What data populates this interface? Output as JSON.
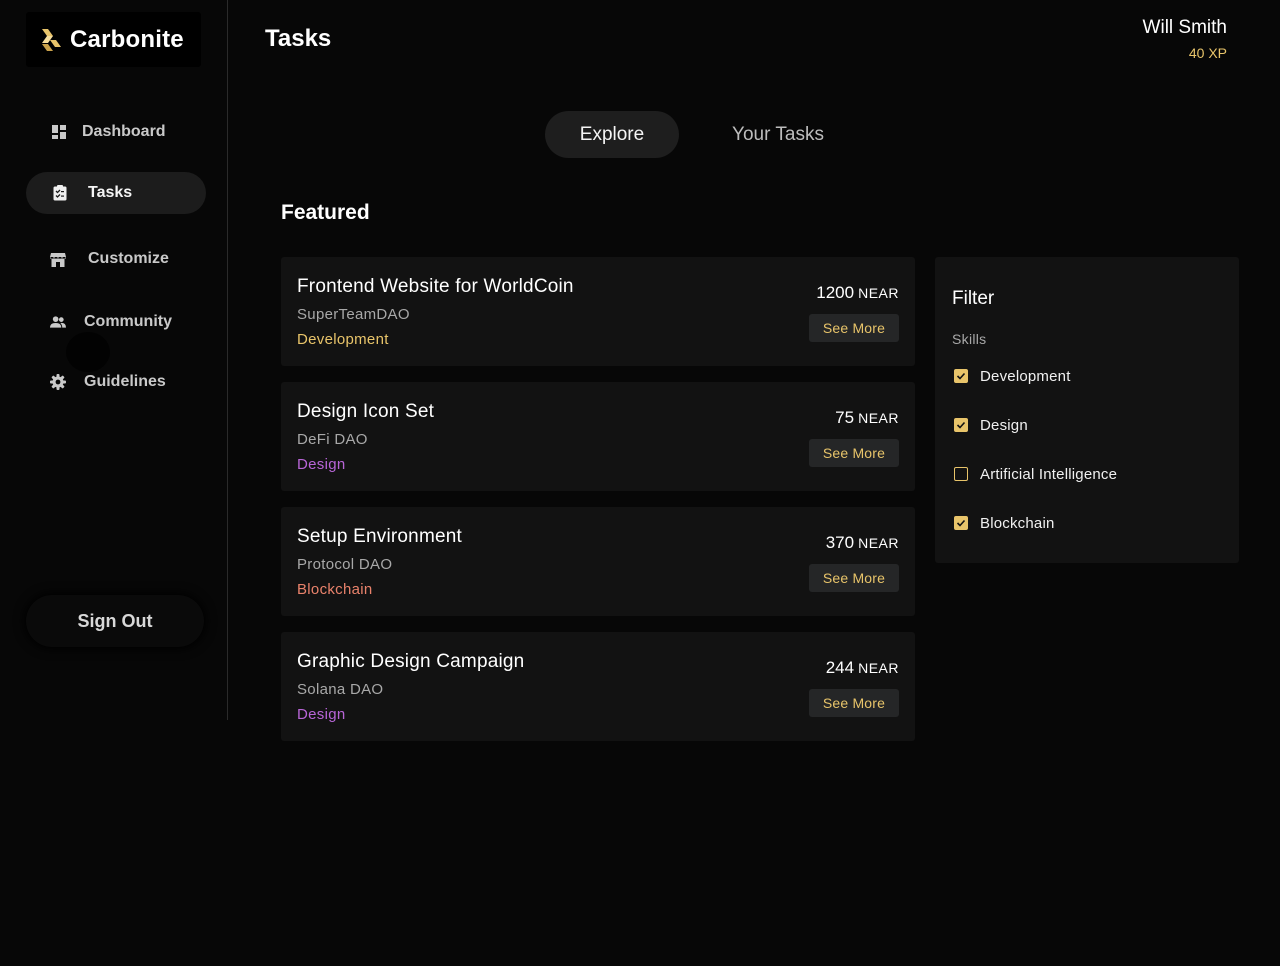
{
  "brand": {
    "name": "Carbonite",
    "accent": "#e8c46a"
  },
  "sidebar": {
    "items": [
      {
        "label": "Dashboard",
        "icon": "dashboard-icon",
        "active": false
      },
      {
        "label": "Tasks",
        "icon": "clipboard-icon",
        "active": true
      },
      {
        "label": "Customize",
        "icon": "store-icon",
        "active": false
      },
      {
        "label": "Community",
        "icon": "people-icon",
        "active": false
      },
      {
        "label": "Guidelines",
        "icon": "gear-icon",
        "active": false
      }
    ],
    "signout_label": "Sign Out"
  },
  "header": {
    "title": "Tasks",
    "user_name": "Will Smith",
    "user_xp": "40 XP"
  },
  "tabs": [
    {
      "label": "Explore",
      "active": true
    },
    {
      "label": "Your Tasks",
      "active": false
    }
  ],
  "featured": {
    "title": "Featured",
    "see_more_label": "See More",
    "tasks": [
      {
        "title": "Frontend Website for WorldCoin",
        "org": "SuperTeamDAO",
        "category": "Development",
        "category_color": "#e8c46a",
        "amount": "1200",
        "unit": "NEAR"
      },
      {
        "title": "Design Icon Set",
        "org": "DeFi DAO",
        "category": "Design",
        "category_color": "#b765d6",
        "amount": "75",
        "unit": "NEAR"
      },
      {
        "title": "Setup Environment",
        "org": "Protocol DAO",
        "category": "Blockchain",
        "category_color": "#e9826b",
        "amount": "370",
        "unit": "NEAR"
      },
      {
        "title": "Graphic Design Campaign",
        "org": "Solana DAO",
        "category": "Design",
        "category_color": "#b765d6",
        "amount": "244",
        "unit": "NEAR"
      }
    ]
  },
  "filter": {
    "title": "Filter",
    "subtitle": "Skills",
    "options": [
      {
        "label": "Development",
        "checked": true
      },
      {
        "label": "Design",
        "checked": true
      },
      {
        "label": "Artificial Intelligence",
        "checked": false
      },
      {
        "label": "Blockchain",
        "checked": true
      }
    ]
  }
}
